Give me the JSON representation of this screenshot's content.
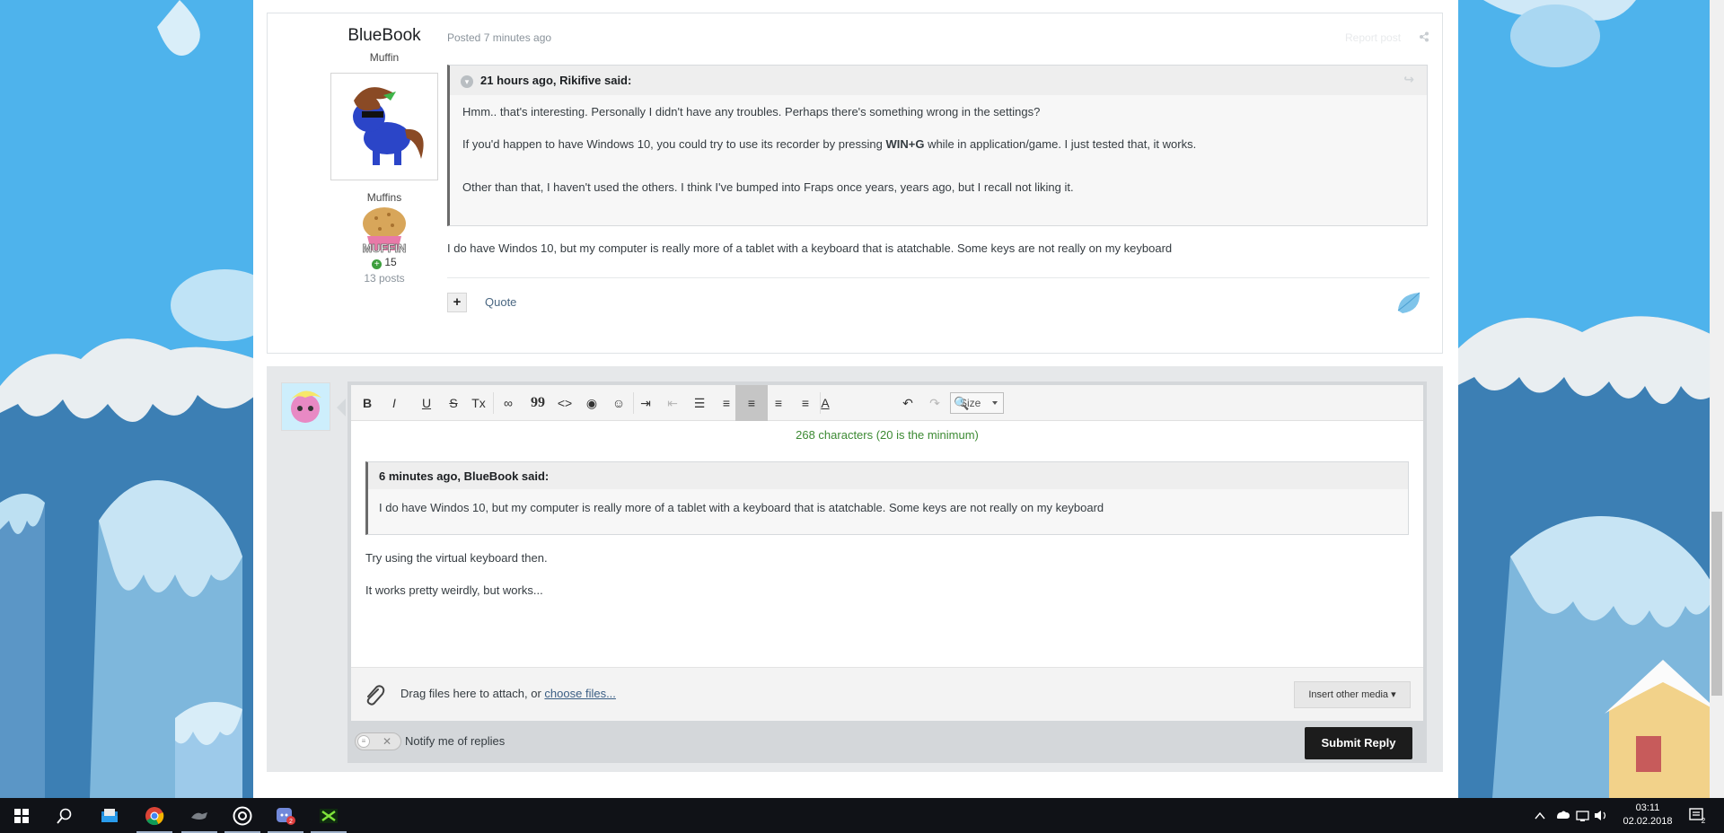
{
  "post": {
    "author_name": "BlueBook",
    "author_title": "Muffin",
    "author_rank": "Muffins",
    "badge_text": "MUFFIN",
    "reputation": "15",
    "post_count": "13 posts",
    "posted": "Posted 7 minutes ago",
    "report_label": "Report post",
    "quote": {
      "header": "21 hours ago, Rikifive said:",
      "line1": "Hmm.. that's interesting. Personally I didn't have any troubles. Perhaps there's something wrong in the settings?",
      "line2_pre": "If you'd happen to have Windows 10, you could try to use its recorder by pressing ",
      "line2_bold": "WIN+G",
      "line2_post": " while in application/game. I just tested that, it works.",
      "line3": "Other than that, I haven't used the others. I think I've bumped into Fraps once years, years ago, but I recall not liking it."
    },
    "body": "I do have Windos 10, but my computer is really more of a tablet with a keyboard that is atatchable. Some keys are not really on my keyboard",
    "quote_label": "Quote",
    "plus_label": "+"
  },
  "editor": {
    "toolbar": [
      {
        "icon": "bold-icon",
        "glyph": "B"
      },
      {
        "icon": "italic-icon",
        "glyph": "I"
      },
      {
        "icon": "underline-icon",
        "glyph": "U"
      },
      {
        "icon": "strikethrough-icon",
        "glyph": "S"
      },
      {
        "icon": "remove-format-icon",
        "glyph": "Tx"
      },
      {
        "icon": "link-icon",
        "glyph": "∞"
      },
      {
        "icon": "quote-icon",
        "glyph": "99"
      },
      {
        "icon": "code-icon",
        "glyph": "<>"
      },
      {
        "icon": "spoiler-icon",
        "glyph": "◉"
      },
      {
        "icon": "emoticon-icon",
        "glyph": "☺"
      },
      {
        "icon": "indent-icon",
        "glyph": "⇥"
      },
      {
        "icon": "outdent-icon",
        "glyph": "⇤"
      },
      {
        "icon": "bullet-list-icon",
        "glyph": "☰"
      },
      {
        "icon": "numbered-list-icon",
        "glyph": "≡"
      },
      {
        "icon": "align-left-icon",
        "glyph": "≡"
      },
      {
        "icon": "align-center-icon",
        "glyph": "≡"
      },
      {
        "icon": "align-right-icon",
        "glyph": "≡"
      },
      {
        "icon": "text-color-icon",
        "glyph": "A"
      },
      {
        "icon": "undo-icon",
        "glyph": "↶"
      },
      {
        "icon": "redo-icon",
        "glyph": "↷"
      },
      {
        "icon": "preview-icon",
        "glyph": "🔍"
      }
    ],
    "size_label": "Size",
    "counter": "268 characters (20 is the minimum)",
    "quote_header": "6 minutes ago, BlueBook said:",
    "quote_body": "I do have Windos 10, but my computer is really more of a tablet with a keyboard that is atatchable. Some keys are not really on my keyboard",
    "line1": "Try using the virtual keyboard then.",
    "line2": "It works pretty weirdly, but works...",
    "attach_text": "Drag files here to attach, or ",
    "attach_link": "choose files...",
    "insert_media": "Insert other media ▾",
    "notify_label": "Notify me of replies",
    "submit": "Submit Reply"
  },
  "taskbar": {
    "apps": [
      "windows-start-icon",
      "search-icon",
      "file-explorer-icon",
      "chrome-icon",
      "pony-app-icon",
      "obs-icon",
      "discord-icon",
      "game-app-icon"
    ],
    "discord_badge": "2",
    "time": "03:11",
    "date": "02.02.2018",
    "notifications": "2"
  },
  "colors": {
    "accent_green": "#3c8a33",
    "link": "#3b5e84",
    "submit_bg": "#1c1c1c"
  }
}
